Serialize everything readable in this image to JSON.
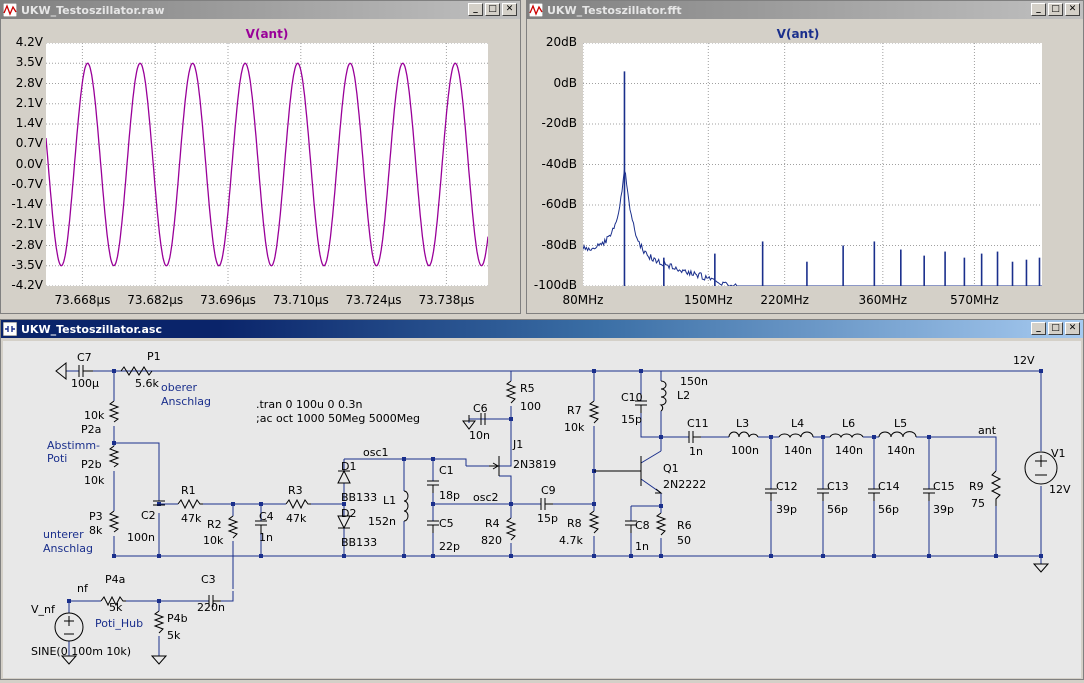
{
  "colors": {
    "raw_trace": "#990099",
    "fft_trace": "#1a2f8c",
    "schematic_wire": "#1a2f8c",
    "schematic_bg": "#e8e8e8"
  },
  "window_raw": {
    "title": "UKW_Testoszillator.raw",
    "controls": [
      "_",
      "□",
      "✕"
    ],
    "trace_label": "V(ant)",
    "y_ticks": [
      "4.2V",
      "3.5V",
      "2.8V",
      "2.1V",
      "1.4V",
      "0.7V",
      "0.0V",
      "-0.7V",
      "-1.4V",
      "-2.1V",
      "-2.8V",
      "-3.5V",
      "-4.2V"
    ],
    "x_ticks": [
      "73.668µs",
      "73.682µs",
      "73.696µs",
      "73.710µs",
      "73.724µs",
      "73.738µs"
    ]
  },
  "window_fft": {
    "title": "UKW_Testoszillator.fft",
    "controls": [
      "_",
      "□",
      "✕"
    ],
    "trace_label": "V(ant)",
    "y_ticks": [
      "20dB",
      "0dB",
      "-20dB",
      "-40dB",
      "-60dB",
      "-80dB",
      "-100dB"
    ],
    "x_ticks": [
      "80MHz",
      "150MHz",
      "220MHz",
      "360MHz",
      "570MHz"
    ]
  },
  "window_asc": {
    "title": "UKW_Testoszillator.asc",
    "controls": [
      "_",
      "□",
      "✕"
    ]
  },
  "chart_data": [
    {
      "type": "line",
      "title": "V(ant)",
      "xlabel": "",
      "ylabel": "",
      "xlim": [
        73.661,
        73.746
      ],
      "ylim": [
        -4.2,
        4.2
      ],
      "x_unit": "µs",
      "y_unit": "V",
      "series": [
        {
          "name": "V(ant)",
          "amplitude": 3.5,
          "period_us": 0.0101,
          "peak_times_us": [
            73.669,
            73.679,
            73.689,
            73.699,
            73.709,
            73.719,
            73.73,
            73.74
          ]
        }
      ]
    },
    {
      "type": "line",
      "title": "V(ant)",
      "xlabel": "",
      "ylabel": "",
      "x_scale": "log",
      "xlim": [
        80,
        800
      ],
      "ylim": [
        -100,
        20
      ],
      "x_unit": "MHz",
      "y_unit": "dB",
      "series": [
        {
          "name": "V(ant)",
          "fundamental_MHz": 98.5,
          "fundamental_dB": 6,
          "harmonics_MHz": [
            120,
            155,
            197,
            246,
            295,
            345,
            394,
            443,
            492,
            542,
            591,
            640,
            690,
            740,
            790
          ],
          "harmonics_dB": [
            -86,
            -84,
            -78,
            -88,
            -80,
            -78,
            -82,
            -85,
            -83,
            -86,
            -84,
            -83,
            -88,
            -87,
            -86
          ]
        }
      ]
    }
  ],
  "schematic": {
    "directive_tran": ".tran 0 100u 0 0.3n",
    "directive_ac": ";ac oct 1000 50Meg 5000Meg",
    "comments": [
      "oberer",
      "Anschlag",
      "Abstimm-",
      "Poti",
      "unterer",
      "Anschlag",
      "Poti_Hub"
    ],
    "components": [
      {
        "ref": "C7",
        "value": "100µ"
      },
      {
        "ref": "P1",
        "value": "5.6k"
      },
      {
        "ref": "P2a",
        "value": "10k"
      },
      {
        "ref": "P2b",
        "value": "10k"
      },
      {
        "ref": "P3",
        "value": "8k"
      },
      {
        "ref": "C2",
        "value": "100n"
      },
      {
        "ref": "R1",
        "value": "47k"
      },
      {
        "ref": "R2",
        "value": "10k"
      },
      {
        "ref": "C4",
        "value": "1n"
      },
      {
        "ref": "R3",
        "value": "47k"
      },
      {
        "ref": "D1",
        "value": "BB133"
      },
      {
        "ref": "D2",
        "value": "BB133"
      },
      {
        "ref": "L1",
        "value": "152n"
      },
      {
        "ref": "C1",
        "value": "18p"
      },
      {
        "ref": "C5",
        "value": "22p"
      },
      {
        "ref": "C6",
        "value": "10n"
      },
      {
        "ref": "R5",
        "value": "100"
      },
      {
        "ref": "J1",
        "value": "2N3819"
      },
      {
        "ref": "R4",
        "value": "820"
      },
      {
        "ref": "C9",
        "value": "15p"
      },
      {
        "ref": "R7",
        "value": "10k"
      },
      {
        "ref": "R8",
        "value": "4.7k"
      },
      {
        "ref": "C10",
        "value": "15p"
      },
      {
        "ref": "L2",
        "value": "150n"
      },
      {
        "ref": "Q1",
        "value": "2N2222"
      },
      {
        "ref": "C8",
        "value": "1n"
      },
      {
        "ref": "R6",
        "value": "50"
      },
      {
        "ref": "C11",
        "value": "1n"
      },
      {
        "ref": "L3",
        "value": "100n"
      },
      {
        "ref": "L4",
        "value": "140n"
      },
      {
        "ref": "L6",
        "value": "140n"
      },
      {
        "ref": "L5",
        "value": "140n"
      },
      {
        "ref": "C12",
        "value": "39p"
      },
      {
        "ref": "C13",
        "value": "56p"
      },
      {
        "ref": "C14",
        "value": "56p"
      },
      {
        "ref": "C15",
        "value": "39p"
      },
      {
        "ref": "R9",
        "value": "75"
      },
      {
        "ref": "V1",
        "value": "12V"
      },
      {
        "ref": "C3",
        "value": "220n"
      },
      {
        "ref": "P4a",
        "value": "5k"
      },
      {
        "ref": "P4b",
        "value": "5k"
      },
      {
        "ref": "V_nf",
        "value": "SINE(0 100m 10k)"
      }
    ],
    "nets": [
      "osc1",
      "osc2",
      "ant",
      "nf",
      "12V"
    ]
  }
}
